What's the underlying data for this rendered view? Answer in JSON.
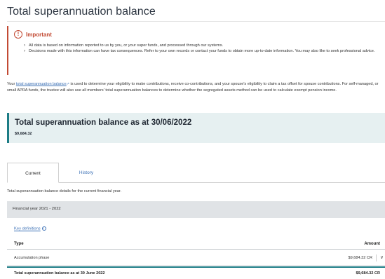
{
  "page": {
    "title": "Total superannuation balance"
  },
  "alert": {
    "title": "Important",
    "icon": "exclamation-circle-icon",
    "items": [
      "All data is based on information reported to us by you, or your super funds, and processed through our systems.",
      "Decisions made with this information can have tax consequences. Refer to your own records or contact your funds to obtain more up-to-date information. You may also like to seek professional advice."
    ]
  },
  "intro": {
    "prefix": "Your ",
    "link_text": "total superannuation balance",
    "suffix": " is used to determine your eligibility to make contributions, receive co-contributions, and your spouse's eligibility to claim a tax offset for spouse contributions. For self-managed, or small APRA funds, the trustee will also use all members' total superannuation balances to determine whether the segregated assets method can be used to calculate exempt pension income."
  },
  "balance": {
    "heading": "Total superannuation balance as at 30/06/2022",
    "value": "$9,684.32"
  },
  "tabs": [
    {
      "label": "Current",
      "active": true
    },
    {
      "label": "History",
      "active": false
    }
  ],
  "tab_description": "Total superannuation balance details for the current financial year.",
  "financial_year": "Financial year 2021 - 2022",
  "key_definitions": "Key definitions",
  "table": {
    "headers": {
      "type": "Type",
      "amount": "Amount"
    },
    "rows": [
      {
        "type": "Accumulation phase",
        "amount": "$9,684.32 CR"
      }
    ],
    "total": {
      "label": "Total superannuation balance as at 30 June 2022",
      "amount": "$9,684.32 CR"
    }
  },
  "colors": {
    "accent": "#1c7c85",
    "alert": "#c24a33",
    "link": "#3a6fb5"
  }
}
